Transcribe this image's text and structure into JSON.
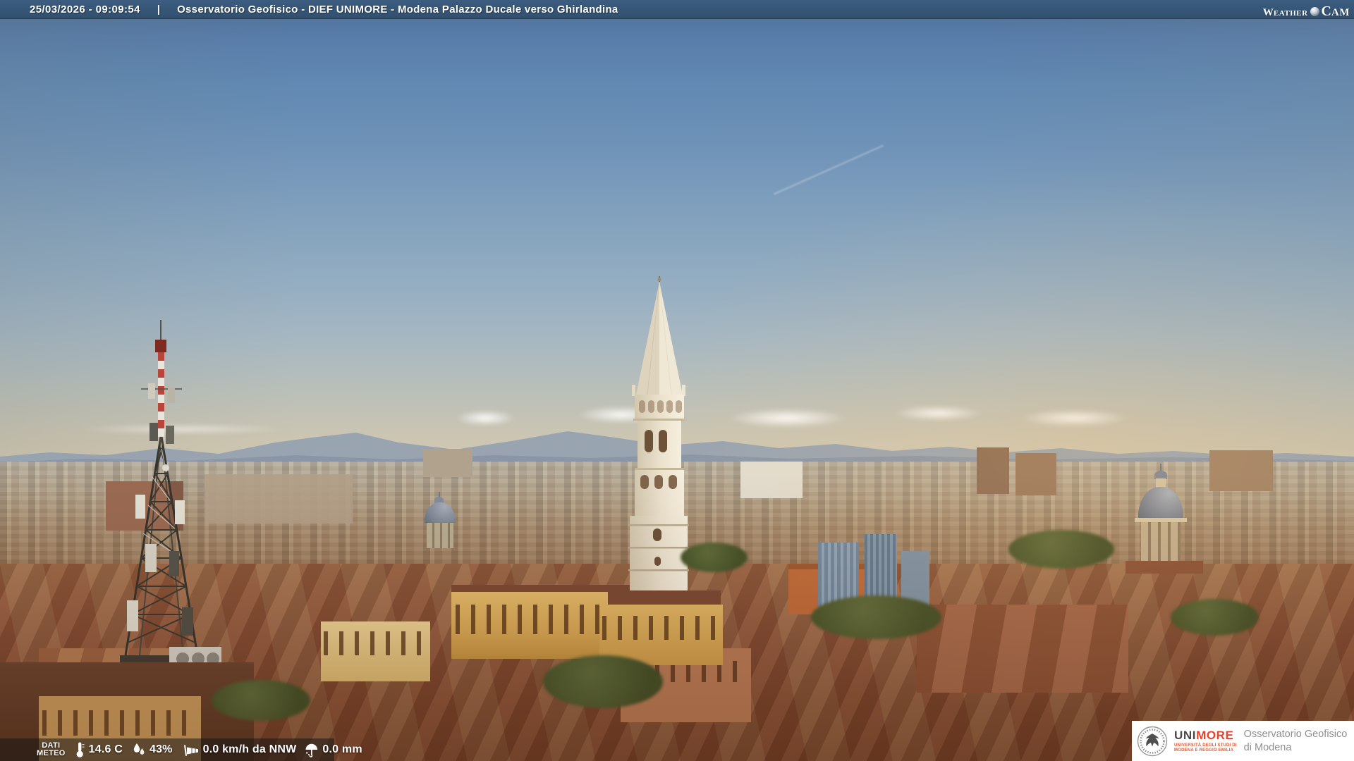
{
  "header": {
    "datetime": "25/03/2026 - 09:09:54",
    "separator": "|",
    "title": "Osservatorio Geofisico - DIEF UNIMORE - Modena Palazzo Ducale verso Ghirlandina",
    "brand": {
      "weather_initial": "W",
      "weather_rest": "EATHER",
      "cam_initial": "C",
      "cam_rest": "AM"
    }
  },
  "weather_bar": {
    "label": {
      "line1": "DATI",
      "line2": "METEO"
    },
    "metrics": [
      {
        "icon": "thermometer-icon",
        "value": "14.6 C"
      },
      {
        "icon": "humidity-icon",
        "value": "43%"
      },
      {
        "icon": "wind-icon",
        "value": "0.0 km/h da NNW"
      },
      {
        "icon": "rain-icon",
        "value": "0.0 mm"
      }
    ]
  },
  "logo_box": {
    "uni": "UNI",
    "more": "MORE",
    "subtitle1": "UNIVERSITÀ DEGLI STUDI DI",
    "subtitle2": "MODENA E REGGIO EMILIA",
    "org1": "Osservatorio Geofisico",
    "org2": "di Modena"
  },
  "scene": {
    "type": "webcam-photo",
    "description": "Morning panorama of Modena: blue sky, Apennine ridge on the horizon, Ghirlandina tower at centre, red-white telecom lattice mast at left, church domes and terracotta rooftops",
    "colors": {
      "topbar": "#35536f",
      "sky_top": "#4d6d92",
      "sky_horizon": "#d3cab1",
      "mountains": "#93a0b0",
      "rooftops": "#8b5840",
      "accent_red": "#e5432d",
      "logo_grey": "#8f8f8f"
    }
  }
}
